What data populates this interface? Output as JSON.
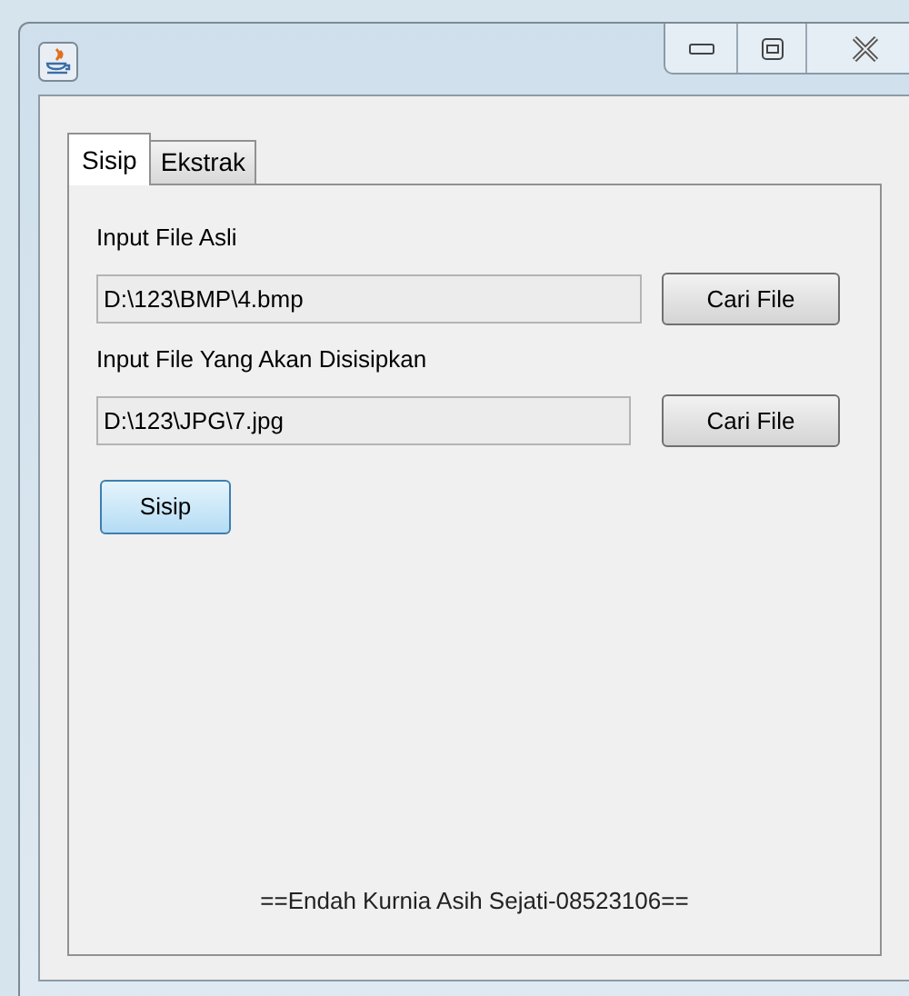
{
  "tabs": [
    {
      "label": "Sisip",
      "selected": true
    },
    {
      "label": "Ekstrak",
      "selected": false
    }
  ],
  "fields": [
    {
      "label": "Input File Asli",
      "value": "D:\\123\\BMP\\4.bmp",
      "button": "Cari File"
    },
    {
      "label": "Input File Yang Akan Disisipkan",
      "value": "D:\\123\\JPG\\7.jpg",
      "button": "Cari File"
    }
  ],
  "action_button": {
    "label": "Sisip",
    "focused": true
  },
  "footer": "==Endah Kurnia Asih Sejati-08523106=="
}
